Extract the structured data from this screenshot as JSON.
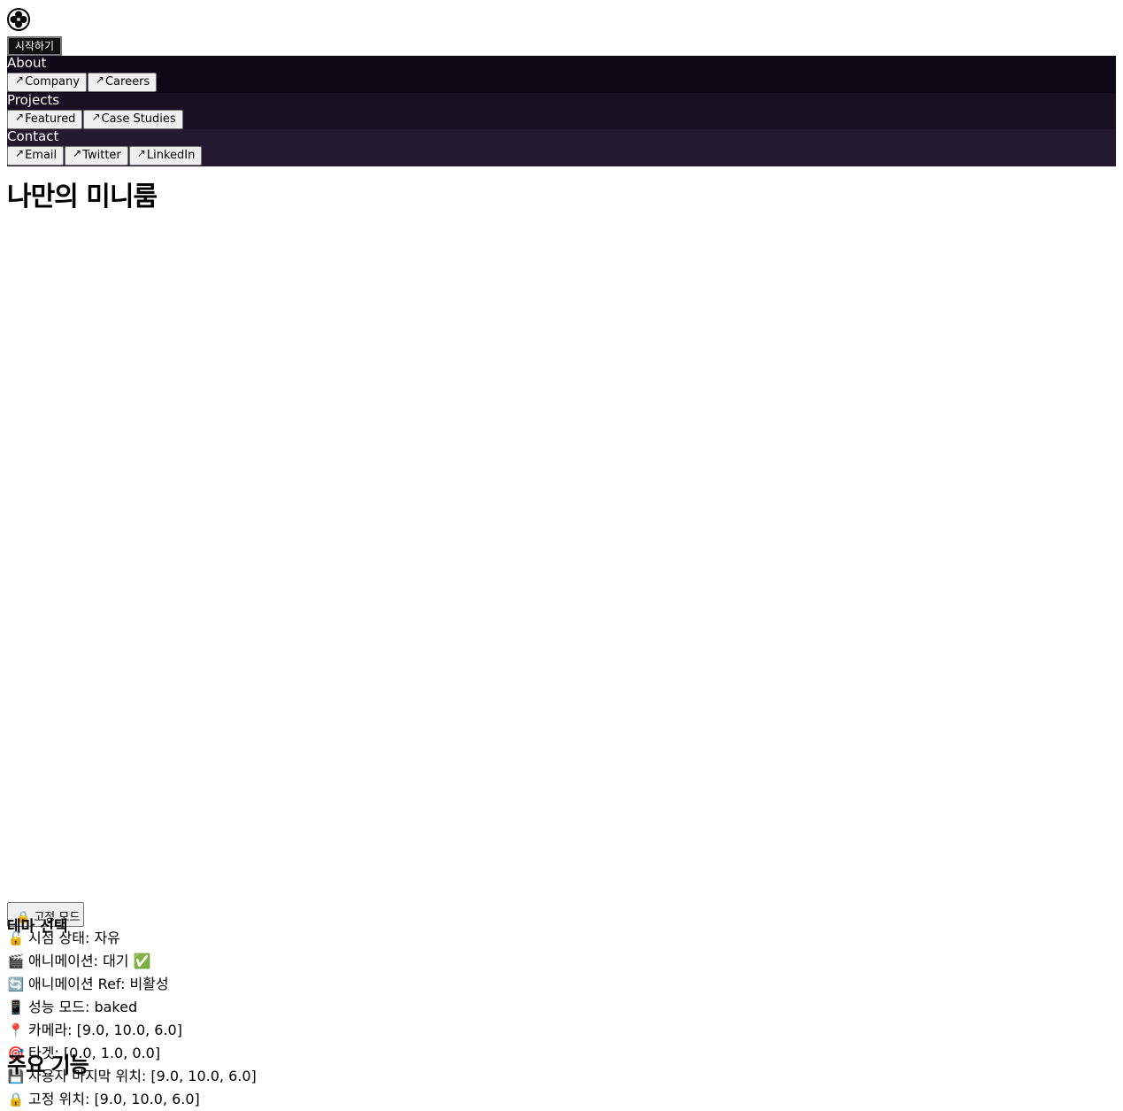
{
  "header": {
    "logo_icon": "quad-circle-logo-icon",
    "start_label": "시작하기"
  },
  "menu": {
    "sections": [
      {
        "title": "About",
        "bg": "#0f0816",
        "links": [
          "Company",
          "Careers"
        ]
      },
      {
        "title": "Projects",
        "bg": "#1a1023",
        "links": [
          "Featured",
          "Case Studies"
        ]
      },
      {
        "title": "Contact",
        "bg": "#241b30",
        "links": [
          "Email",
          "Twitter",
          "LinkedIn"
        ]
      }
    ],
    "link_arrow": "↗"
  },
  "main": {
    "title": "나만의 미니룸",
    "fixed_mode_label": "🔒 고정 모드",
    "theme_heading": "테마 선택",
    "features_heading": "주요 기능"
  },
  "status": [
    {
      "icon": "🔓",
      "text": "시점 상태: 자유"
    },
    {
      "icon": "🎬",
      "text": "애니메이션: 대기 ✅"
    },
    {
      "icon": "🔄",
      "text": "애니메이션 Ref: 비활성"
    },
    {
      "icon": "📱",
      "text": "성능 모드: baked"
    },
    {
      "icon": "📍",
      "text": "카메라: [9.0, 10.0, 6.0]"
    },
    {
      "icon": "🎯",
      "text": "타겟: [0.0, 1.0, 0.0]"
    },
    {
      "icon": "💾",
      "text": "사용자 마지막 위치: [9.0, 10.0, 6.0]"
    },
    {
      "icon": "🔒",
      "text": "고정 위치: [9.0, 10.0, 6.0]"
    }
  ]
}
